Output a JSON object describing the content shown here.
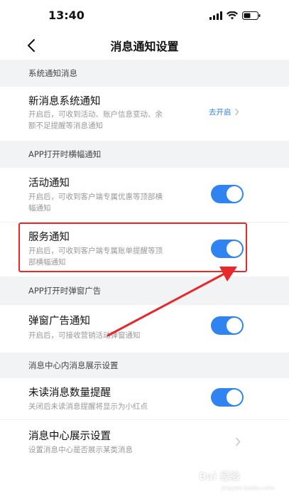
{
  "status": {
    "time": "13:40"
  },
  "nav": {
    "title": "消息通知设置"
  },
  "sections": {
    "system": "系统通知消息",
    "banner": "APP打开时横幅通知",
    "popup": "APP打开时弹窗广告",
    "center": "消息中心内消息展示设置"
  },
  "rows": {
    "new_system": {
      "title": "新消息系统通知",
      "desc_line1": "开启后，可收到活动、账户信息变动、余",
      "desc_line2": "额不足提醒等消息通知",
      "action": "去开启"
    },
    "activity": {
      "title": "活动通知",
      "desc_line1": "开启后，可收到客户端专属优惠等顶部横",
      "desc_line2": "幅通知",
      "enabled": true
    },
    "service": {
      "title": "服务通知",
      "desc_line1": "开启后，可收到客户端专属账单提醒等顶",
      "desc_line2": "部横幅通知",
      "enabled": true
    },
    "popup_ad": {
      "title": "弹窗广告通知",
      "desc_line1": "开启后，可接收营销活动弹窗通知",
      "enabled": true
    },
    "unread": {
      "title": "未读消息数量提醒",
      "desc_line1": "关闭后未读消息提醒将显示为小红点",
      "enabled": true
    },
    "center_display": {
      "title": "消息中心展示设置",
      "desc_line1": "设置消息中心是否展示某类消息"
    }
  },
  "watermark": {
    "brand": "Bai 经验",
    "sub": "jingyan.baidu.com"
  },
  "colors": {
    "accent": "#2f84f2",
    "highlight": "#e8282b",
    "background": "#f2f3f5"
  }
}
